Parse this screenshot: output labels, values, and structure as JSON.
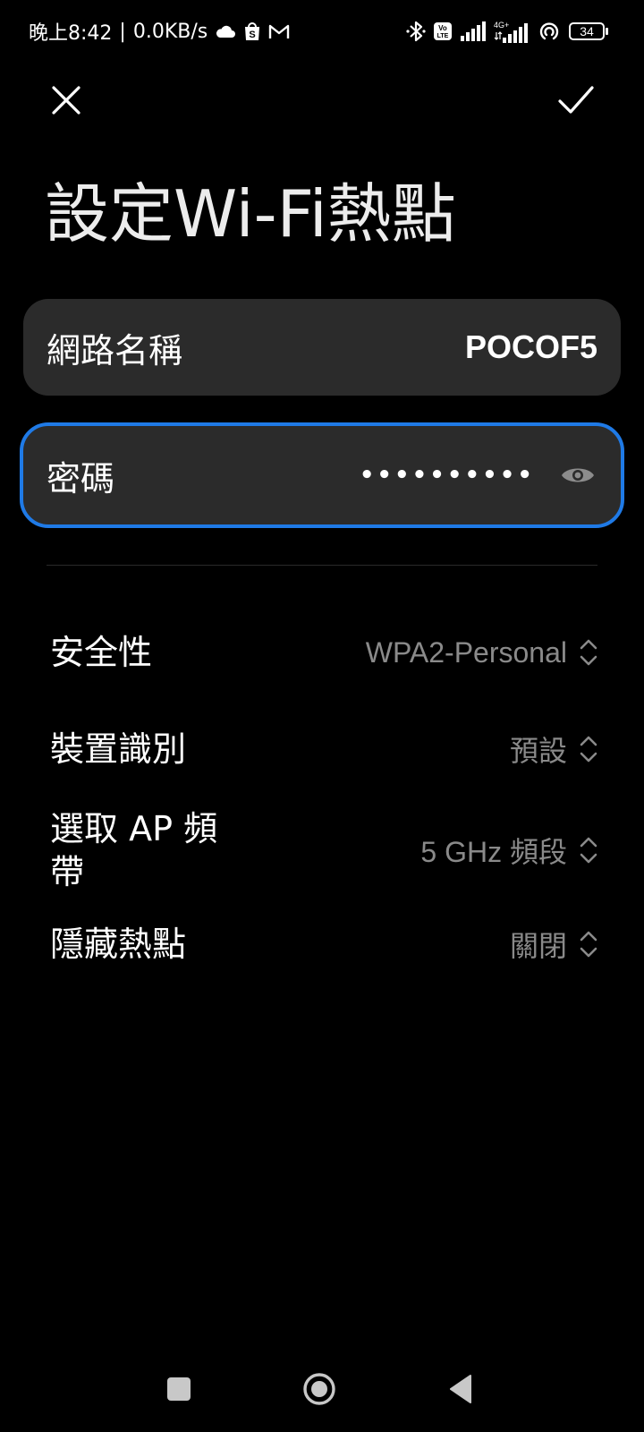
{
  "status_bar": {
    "time": "晚上8:42",
    "separator": "|",
    "speed": "0.0KB/s",
    "left_icons": [
      "cloud-icon",
      "shopee-icon",
      "gmail-icon"
    ],
    "right_icons": [
      "bluetooth-icon",
      "volte-icon",
      "signal-icon",
      "4g-signal-icon",
      "hotspot-icon",
      "battery-icon"
    ],
    "network_type": "4G+",
    "battery": "34"
  },
  "header": {
    "title": "設定Wi-Fi熱點",
    "close_icon": "close-icon",
    "confirm_icon": "check-icon"
  },
  "fields": {
    "ssid": {
      "label": "網路名稱",
      "value": "POCOF5"
    },
    "password": {
      "label": "密碼",
      "masked_value": "••••••••••",
      "toggle_icon": "eye-icon"
    }
  },
  "settings": {
    "security": {
      "label": "安全性",
      "value": "WPA2-Personal"
    },
    "device_id": {
      "label": "裝置識別",
      "value": "預設"
    },
    "ap_band": {
      "label": "選取 AP 頻帶",
      "value": "5 GHz 頻段"
    },
    "hidden": {
      "label": "隱藏熱點",
      "value": "關閉"
    }
  },
  "colors": {
    "background": "#000000",
    "card": "#2b2b2b",
    "accent": "#1f7ae6",
    "secondary_text": "#8a8a8a"
  },
  "nav": {
    "icons": [
      "recents-icon",
      "home-icon",
      "back-icon"
    ]
  }
}
